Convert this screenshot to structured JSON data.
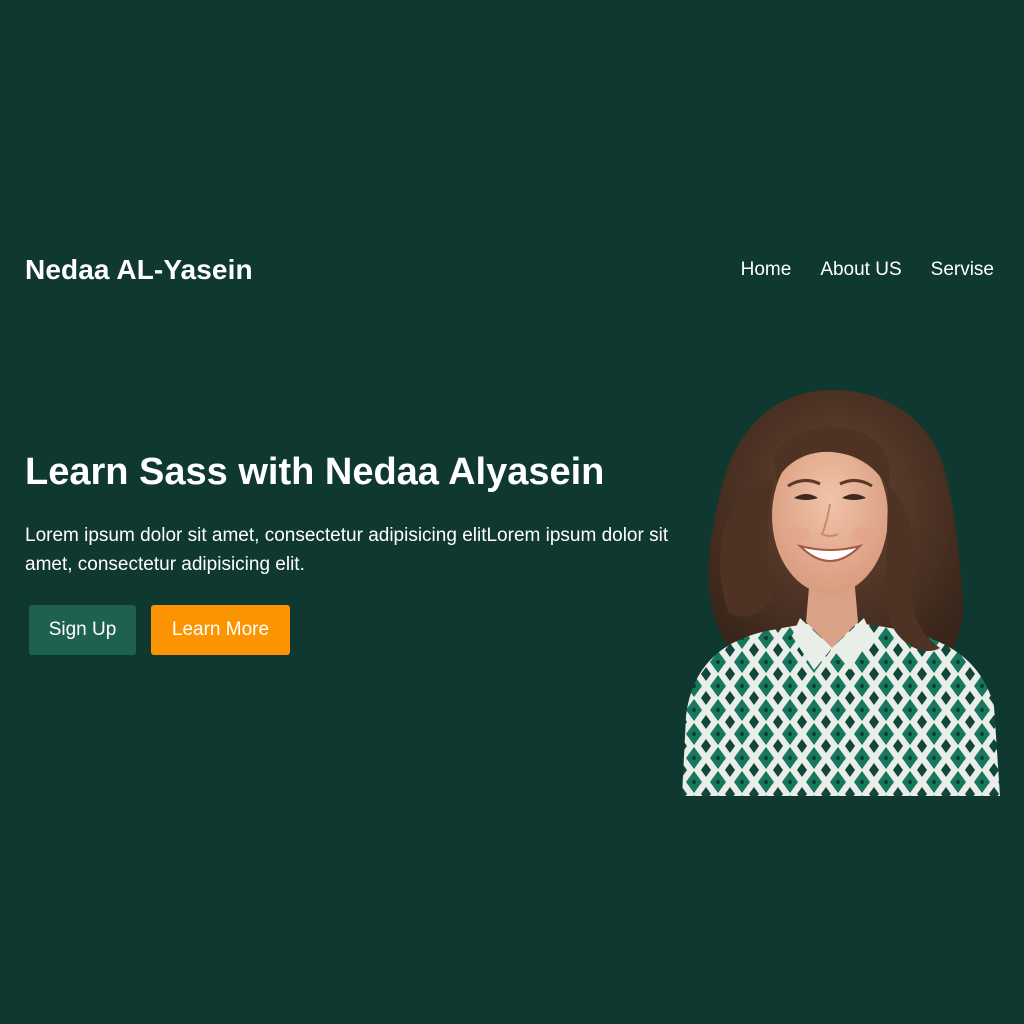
{
  "header": {
    "brand": "Nedaa AL-Yasein",
    "nav": [
      "Home",
      "About US",
      "Servise"
    ]
  },
  "hero": {
    "title": "Learn Sass with Nedaa Alyasein",
    "text": "Lorem ipsum dolor sit amet, consectetur adipisicing elitLorem ipsum dolor sit amet, consectetur adipisicing elit.",
    "buttons": {
      "signup": "Sign Up",
      "learn_more": "Learn More"
    }
  },
  "colors": {
    "background": "#0f3830",
    "signup_button": "#1f6150",
    "learn_more_button": "#fb9400",
    "text": "#ffffff"
  }
}
